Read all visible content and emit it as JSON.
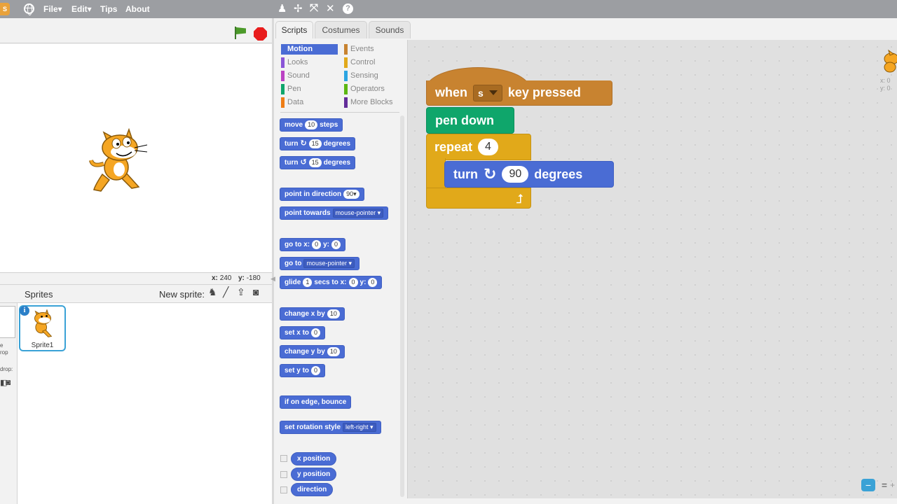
{
  "menu": {
    "file": "File▾",
    "edit": "Edit▾",
    "tips": "Tips",
    "about": "About"
  },
  "toolbar_icons": [
    "duplicate-icon",
    "cut-icon",
    "grow-icon",
    "shrink-icon",
    "help-icon"
  ],
  "stage": {
    "x_label": "x:",
    "x_value": "240",
    "y_label": "y:",
    "y_value": "-180"
  },
  "sprites_panel": {
    "title": "Sprites",
    "new_sprite_label": "New sprite:",
    "left_fragments": {
      "a": "e",
      "b": "rop",
      "c": "drop:"
    },
    "sprite_names": [
      "Sprite1"
    ]
  },
  "tabs": {
    "scripts": "Scripts",
    "costumes": "Costumes",
    "sounds": "Sounds"
  },
  "categories": {
    "motion": "Motion",
    "looks": "Looks",
    "sound": "Sound",
    "pen": "Pen",
    "data": "Data",
    "events": "Events",
    "control": "Control",
    "sensing": "Sensing",
    "operators": "Operators",
    "more": "More Blocks"
  },
  "palette": {
    "move": {
      "a": "move",
      "v": "10",
      "b": "steps"
    },
    "turn_cw": {
      "a": "turn",
      "v": "15",
      "b": "degrees"
    },
    "turn_ccw": {
      "a": "turn",
      "v": "15",
      "b": "degrees"
    },
    "point_dir": {
      "a": "point in direction",
      "v": "90▾"
    },
    "point_towards": {
      "a": "point towards",
      "v": "mouse-pointer ▾"
    },
    "goto_xy": {
      "a": "go to x:",
      "x": "0",
      "b": "y:",
      "y": "0"
    },
    "goto": {
      "a": "go to",
      "v": "mouse-pointer ▾"
    },
    "glide": {
      "a": "glide",
      "s": "1",
      "b": "secs to x:",
      "x": "0",
      "c": "y:",
      "y": "0"
    },
    "change_x": {
      "a": "change x by",
      "v": "10"
    },
    "set_x": {
      "a": "set x to",
      "v": "0"
    },
    "change_y": {
      "a": "change y by",
      "v": "10"
    },
    "set_y": {
      "a": "set y to",
      "v": "0"
    },
    "bounce": {
      "a": "if on edge, bounce"
    },
    "rot_style": {
      "a": "set rotation style",
      "v": "left-right ▾"
    },
    "x_position": "x position",
    "y_position": "y position",
    "direction": "direction"
  },
  "script": {
    "when": "when",
    "key": "s",
    "key_pressed": "key  pressed",
    "pen_down": "pen down",
    "repeat": "repeat",
    "repeat_count": "4",
    "turn": "turn",
    "turn_value": "90",
    "degrees": "degrees"
  },
  "corner": {
    "x": "x: 0",
    "y": "y: 0"
  },
  "colors": {
    "motion": "#4a6cd4",
    "events": "#c88330",
    "pen": "#0fa66b",
    "control": "#e1a91a",
    "looks": "#8a55d7",
    "sound": "#bb42c3",
    "data": "#ee7d16",
    "sensing": "#2ca5e2",
    "operators": "#5cb712",
    "more": "#632d99"
  }
}
